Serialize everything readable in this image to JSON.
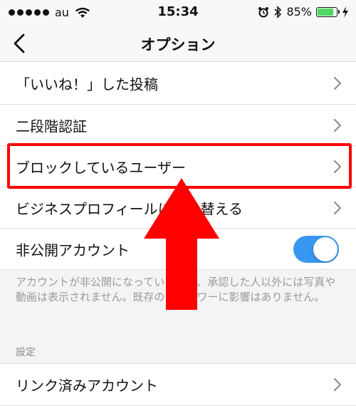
{
  "status_bar": {
    "carrier": "au",
    "time": "15:34",
    "battery_percent": "85%",
    "battery_level": 0.85,
    "icons": [
      "signal-dots",
      "wifi-icon",
      "alarm-icon",
      "bluetooth-icon",
      "battery-icon",
      "charging-bolt-icon"
    ]
  },
  "nav": {
    "title": "オプション",
    "back_icon": "chevron-left-icon"
  },
  "rows": {
    "liked_posts": "「いいね！」した投稿",
    "two_factor": "二段階認証",
    "blocked_users": "ブロックしているユーザー",
    "business_profile": "ビジネスプロフィールに切り替える",
    "private_account": "非公開アカウント"
  },
  "private_account_toggle": {
    "on": true,
    "color": "#3897f0"
  },
  "private_account_description": "アカウントが非公開になっている場合、承認した人以外には写真や動画は表示されません。既存のフォロワーに影響はありません。",
  "sections": {
    "settings_header": "設定"
  },
  "settings_rows": {
    "linked_accounts": "リンク済みアカウント"
  },
  "annotation": {
    "highlight_color": "#ff0000",
    "arrow_color": "#ff0000"
  }
}
